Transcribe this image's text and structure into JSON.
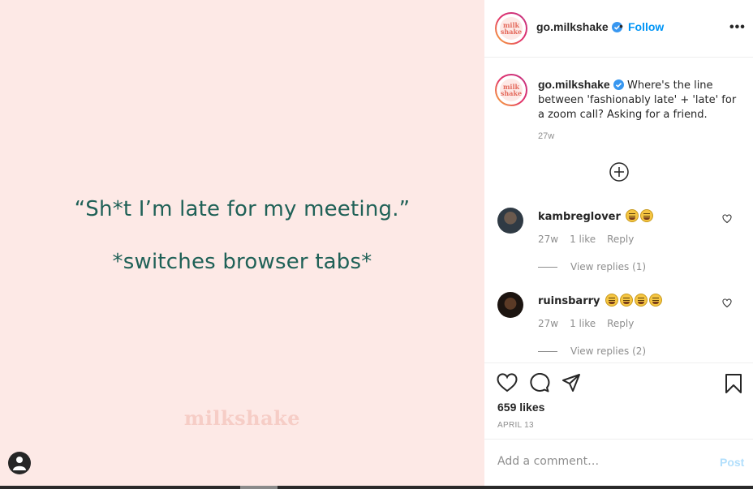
{
  "media": {
    "quote_line1": "“Sh*t I’m late for my meeting.”",
    "quote_line2": "*switches browser tabs*",
    "watermark": "milkshake",
    "background_color": "#fde9e6",
    "text_color": "#1f6157"
  },
  "header": {
    "avatar_text": "milk shake",
    "username": "go.milkshake",
    "separator": "•",
    "follow_label": "Follow",
    "more_label": "•••"
  },
  "caption": {
    "username": "go.milkshake",
    "text": "Where's the line between 'fashionably late' + 'late' for a zoom call? Asking for a friend.",
    "time": "27w"
  },
  "comments": [
    {
      "username": "kambreglover",
      "emoji_count": 2,
      "time": "27w",
      "likes": "1 like",
      "reply_label": "Reply",
      "view_replies": "View replies (1)"
    },
    {
      "username": "ruinsbarry",
      "emoji_count": 4,
      "time": "27w",
      "likes": "1 like",
      "reply_label": "Reply",
      "view_replies": "View replies (2)"
    }
  ],
  "engagement": {
    "likes": "659 likes",
    "date": "APRIL 13"
  },
  "add_comment": {
    "placeholder": "Add a comment…",
    "post_label": "Post"
  },
  "colors": {
    "accent": "#0095f6",
    "post_disabled": "#b2dffc"
  }
}
